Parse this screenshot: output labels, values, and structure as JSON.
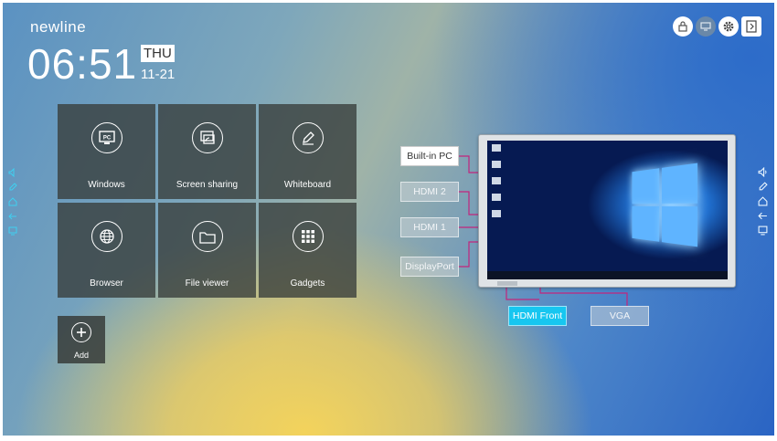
{
  "brand": "newline",
  "clock": {
    "time": "06:51",
    "day": "THU",
    "date": "11-21"
  },
  "apps": [
    {
      "label": "Windows",
      "icon": "pc-icon"
    },
    {
      "label": "Screen sharing",
      "icon": "screen-share-icon"
    },
    {
      "label": "Whiteboard",
      "icon": "pen-icon"
    },
    {
      "label": "Browser",
      "icon": "globe-icon"
    },
    {
      "label": "File viewer",
      "icon": "folder-icon"
    },
    {
      "label": "Gadgets",
      "icon": "grid-icon"
    }
  ],
  "add": {
    "label": "Add",
    "icon": "plus-icon"
  },
  "top_icons": [
    "lock-icon",
    "display-icon",
    "settings-icon",
    "exit-icon"
  ],
  "sidebar_icons": [
    "volume-icon",
    "pen-icon",
    "home-icon",
    "back-icon",
    "tasks-icon"
  ],
  "sources": {
    "builtin": "Built-in PC",
    "hdmi2": "HDMI 2",
    "hdmi1": "HDMI 1",
    "displayport": "DisplayPort",
    "hdmi_front": "HDMI Front",
    "vga": "VGA"
  },
  "colors": {
    "active_source": "#ffffff",
    "front_source": "#17c6f0",
    "connector": "#c2257d"
  }
}
